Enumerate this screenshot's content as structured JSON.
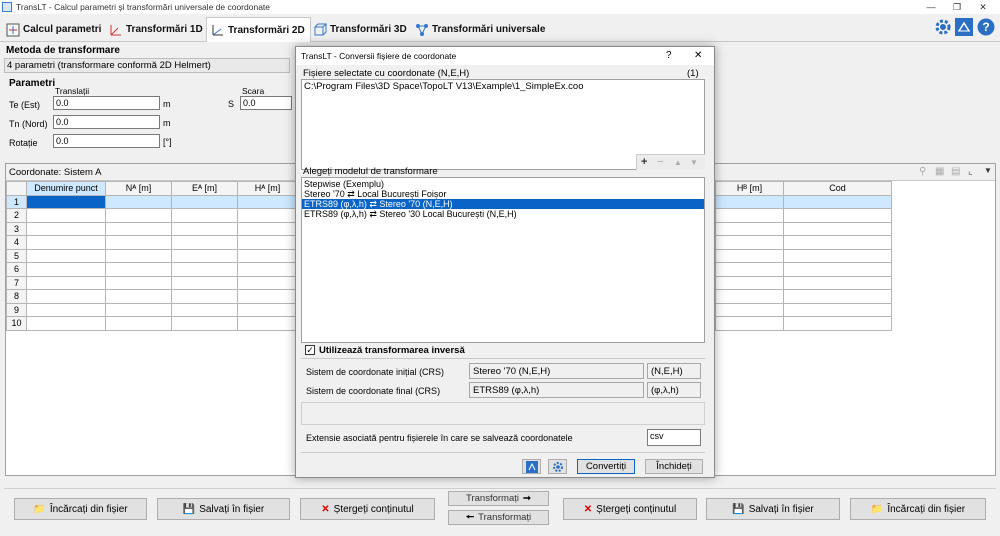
{
  "window": {
    "title": "TransLT - Calcul parametri și transformări universale de coordonate"
  },
  "tabs": [
    {
      "label": "Calcul parametri"
    },
    {
      "label": "Transformări 1D"
    },
    {
      "label": "Transformări 2D"
    },
    {
      "label": "Transformări 3D"
    },
    {
      "label": "Transformări universale"
    }
  ],
  "method": {
    "heading": "Metoda de transformare",
    "value": "4 parametri (transformare conformă 2D Helmert)"
  },
  "params": {
    "heading": "Parametri",
    "translation_label": "Translații",
    "scale_label": "Scara",
    "te_label": "Te (Est)",
    "te_value": "0.0",
    "te_unit": "m",
    "tn_label": "Tn (Nord)",
    "tn_value": "0.0",
    "tn_unit": "m",
    "rot_label": "Rotație",
    "rot_value": "0.0",
    "rot_unit": "[°]",
    "s_label": "S",
    "s_value": "0.0"
  },
  "grid": {
    "heading": "Coordonate: Sistem A",
    "left_headers": [
      "Denumire punct",
      "Nᴬ [m]",
      "Eᴬ [m]",
      "Hᴬ [m]"
    ],
    "right_headers": [
      "Hᴮ [m]",
      "Cod"
    ],
    "rows": [
      "1",
      "2",
      "3",
      "4",
      "5",
      "6",
      "7",
      "8",
      "9",
      "10"
    ]
  },
  "bottom": {
    "load_left": "Încărcați din fișier",
    "save_left": "Salvați în fișier",
    "delete_left": "Ștergeți conținutul",
    "transform_fwd": "Transformați",
    "transform_back": "Transformați",
    "delete_right": "Ștergeți conținutul",
    "save_right": "Salvați în fișier",
    "load_right": "Încărcați din fișier"
  },
  "dialog": {
    "title": "TransLT - Conversii fișiere de coordonate",
    "help": "?",
    "close": "✕",
    "files_label": "Fișiere selectate cu coordonate (N,E,H)",
    "files_count": "(1)",
    "files": [
      "C:\\Program Files\\3D Space\\TopoLT V13\\Example\\1_SimpleEx.coo"
    ],
    "model_label": "Alegeți modelul de transformare",
    "models": [
      "Stepwise (Exemplu)",
      "Stereo '70 ⇄ Local București Foișor",
      "ETRS89 (φ,λ,h) ⇄ Stereo '70 (N,E,H)",
      "ETRS89 (φ,λ,h) ⇄ Stereo '30 Local București (N,E,H)"
    ],
    "selected_model_index": 2,
    "inverse_label": "Utilizează transformarea inversă",
    "inverse_checked": true,
    "crs_init_label": "Sistem de coordonate inițial (CRS)",
    "crs_init_value": "Stereo '70 (N,E,H)",
    "crs_init_short": "(N,E,H)",
    "crs_final_label": "Sistem de coordonate final (CRS)",
    "crs_final_value": "ETRS89 (φ,λ,h)",
    "crs_final_short": "(φ,λ,h)",
    "ext_label": "Extensie asociată pentru fișierele în care se salvează coordonatele",
    "ext_value": "csv",
    "convert_button": "Convertiți",
    "close_button": "Închideți"
  }
}
